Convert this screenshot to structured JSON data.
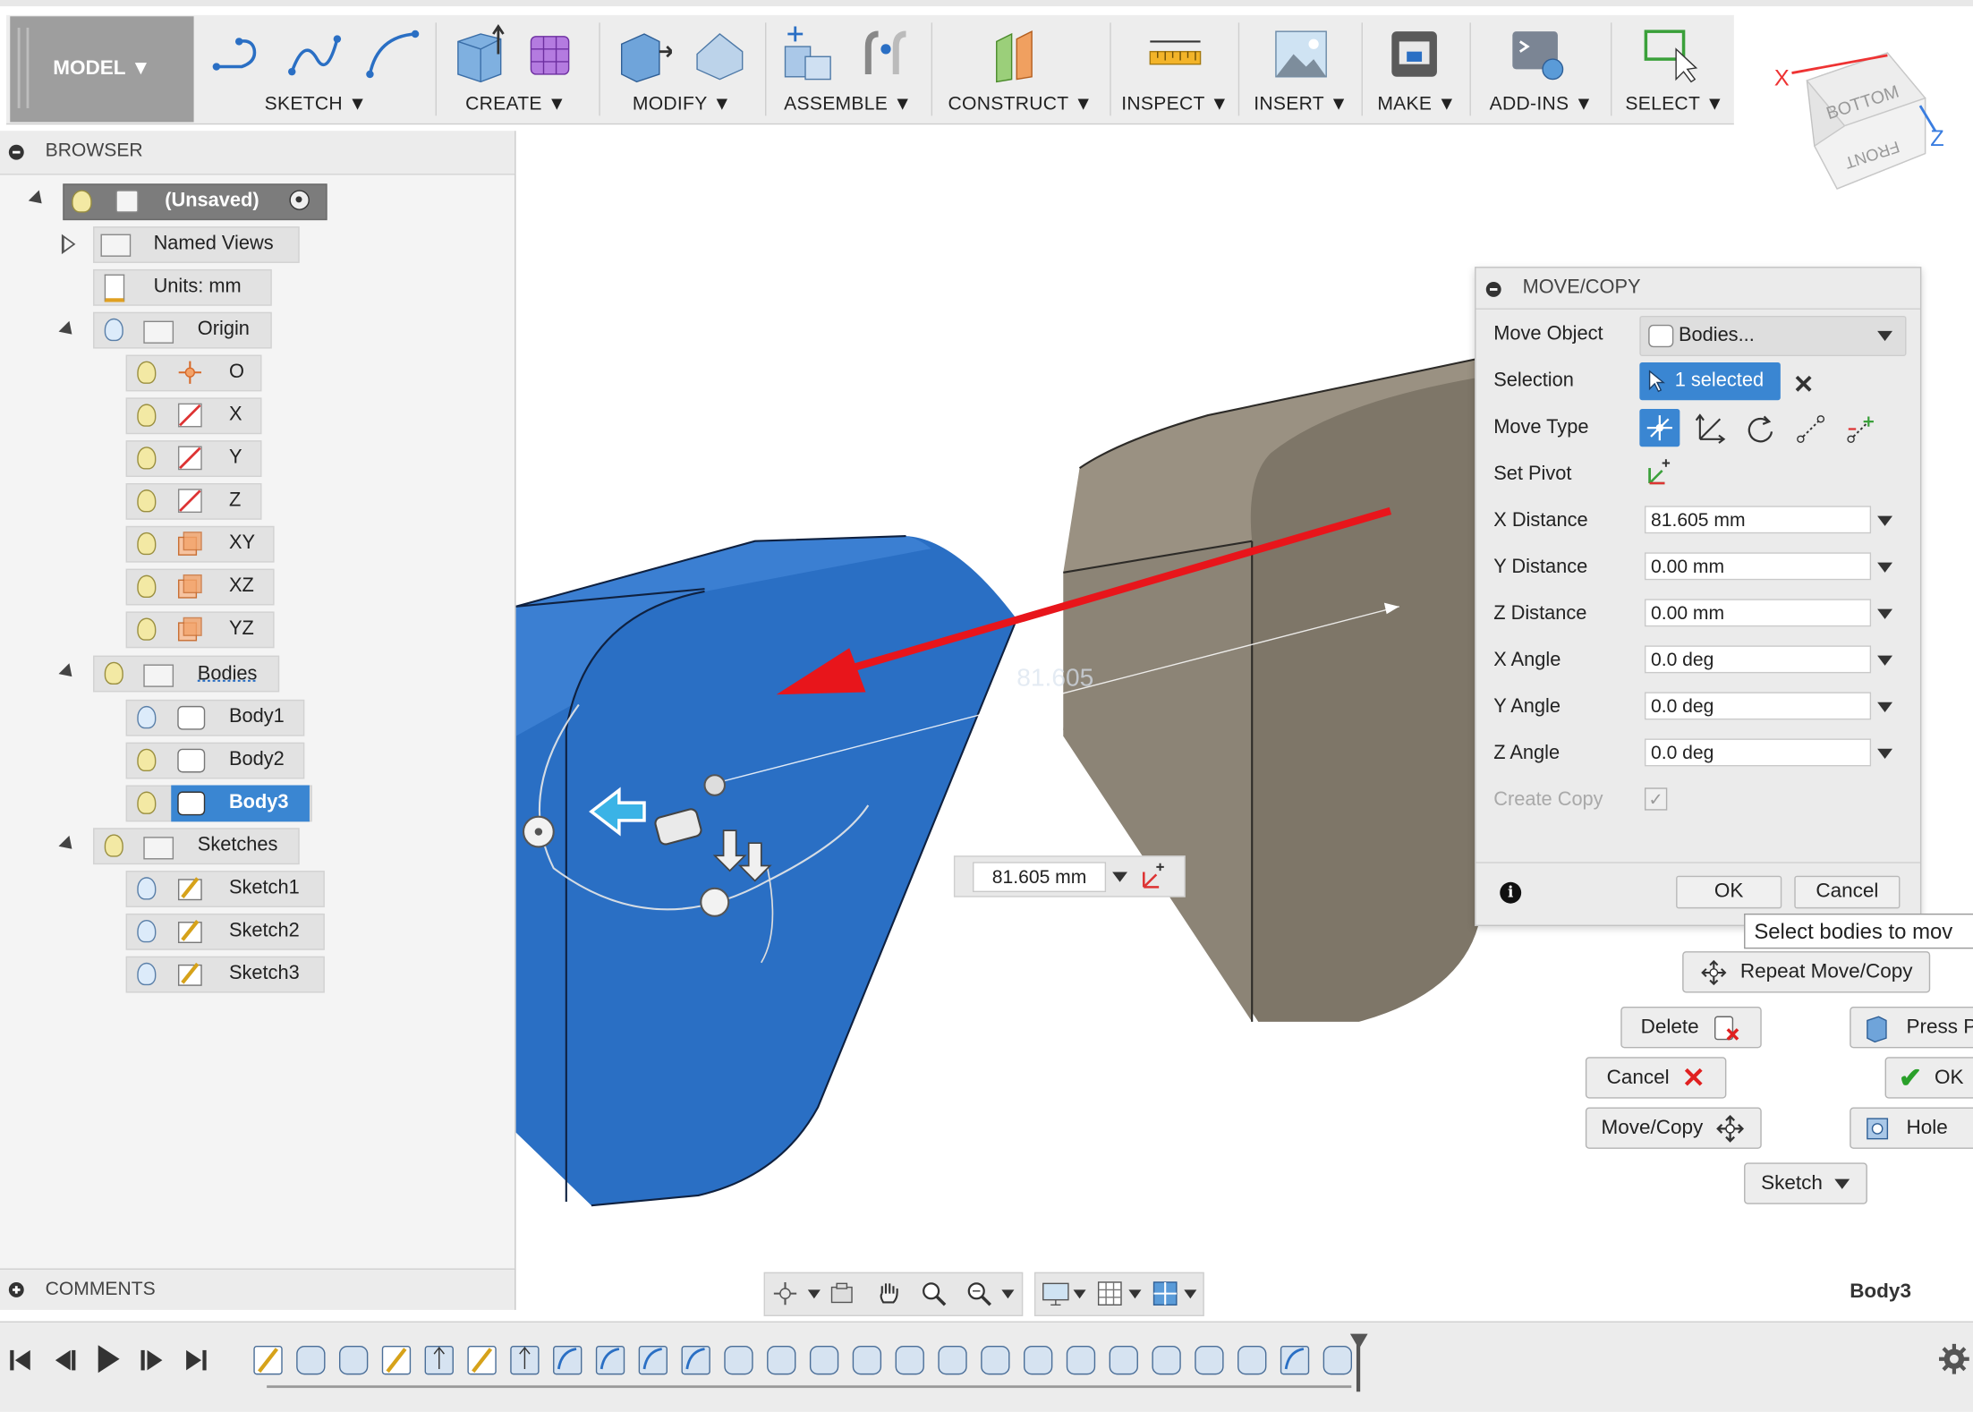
{
  "toolbar": {
    "mode_label": "MODEL ▼",
    "groups": [
      {
        "label": "SKETCH ▼"
      },
      {
        "label": "CREATE ▼"
      },
      {
        "label": "MODIFY ▼"
      },
      {
        "label": "ASSEMBLE ▼"
      },
      {
        "label": "CONSTRUCT ▼"
      },
      {
        "label": "INSPECT ▼"
      },
      {
        "label": "INSERT ▼"
      },
      {
        "label": "MAKE ▼"
      },
      {
        "label": "ADD-INS ▼"
      },
      {
        "label": "SELECT ▼"
      }
    ]
  },
  "viewcube": {
    "top_face": "BOTTOM",
    "front_face": "FRONT",
    "x_axis": "X",
    "z_axis": "Z"
  },
  "browser": {
    "title": "BROWSER",
    "root": "(Unsaved)",
    "named_views": "Named Views",
    "units": "Units: mm",
    "origin": {
      "label": "Origin",
      "items": [
        "O",
        "X",
        "Y",
        "Z",
        "XY",
        "XZ",
        "YZ"
      ]
    },
    "bodies": {
      "label": "Bodies",
      "items": [
        "Body1",
        "Body2",
        "Body3"
      ],
      "selected": "Body3"
    },
    "sketches": {
      "label": "Sketches",
      "items": [
        "Sketch1",
        "Sketch2",
        "Sketch3"
      ]
    }
  },
  "comments": {
    "title": "COMMENTS"
  },
  "dialog": {
    "title": "MOVE/COPY",
    "move_object": {
      "label": "Move Object",
      "value": "Bodies..."
    },
    "selection": {
      "label": "Selection",
      "value": "1 selected"
    },
    "move_type": {
      "label": "Move Type"
    },
    "set_pivot": {
      "label": "Set Pivot"
    },
    "fields": [
      {
        "label": "X Distance",
        "value": "81.605 mm"
      },
      {
        "label": "Y Distance",
        "value": "0.00 mm"
      },
      {
        "label": "Z Distance",
        "value": "0.00 mm"
      },
      {
        "label": "X Angle",
        "value": "0.0 deg"
      },
      {
        "label": "Y Angle",
        "value": "0.0 deg"
      },
      {
        "label": "Z Angle",
        "value": "0.0 deg"
      }
    ],
    "create_copy": {
      "label": "Create Copy",
      "checked": true
    },
    "ok": "OK",
    "cancel": "Cancel"
  },
  "tooltip": "Select bodies to mov",
  "canvas": {
    "dimension_ghost": "81.605",
    "dimension_input": "81.605 mm",
    "selected_body": "Body3",
    "body_color": "#2a6fc4",
    "other_body_color": "#847b6d",
    "arrow_color": "#e8151b"
  },
  "marking_menu": {
    "repeat": "Repeat Move/Copy",
    "delete": "Delete",
    "press_pull": "Press P",
    "cancel": "Cancel",
    "ok": "OK",
    "move_copy": "Move/Copy",
    "hole": "Hole",
    "sketch": "Sketch"
  }
}
